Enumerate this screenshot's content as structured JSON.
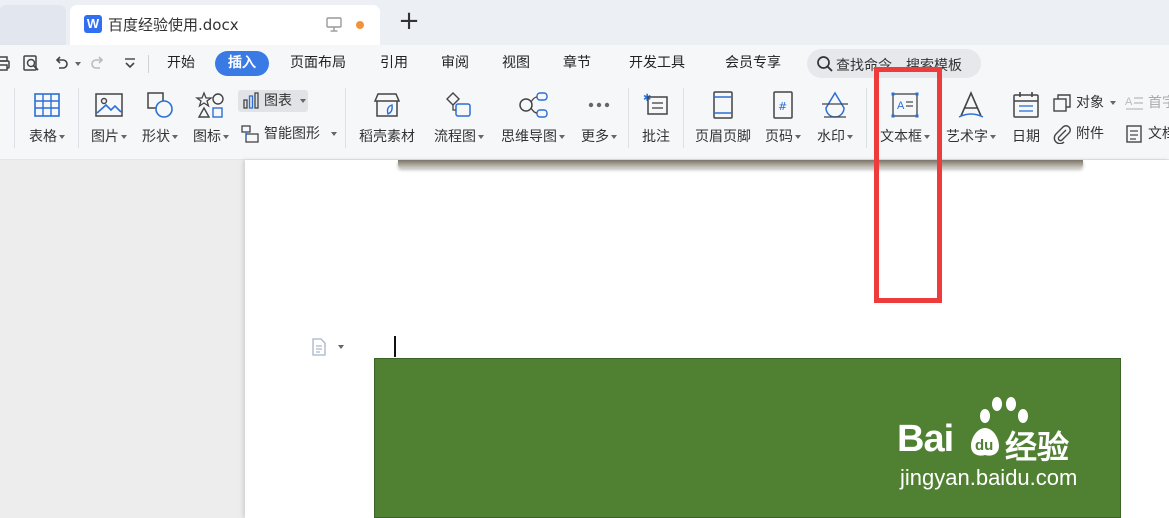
{
  "titlebar": {
    "doc_tab": {
      "logo_letter": "W",
      "title": "百度经验使用.docx"
    }
  },
  "menubar": {
    "tabs": [
      {
        "label": "开始",
        "active": false
      },
      {
        "label": "插入",
        "active": true
      },
      {
        "label": "页面布局",
        "active": false
      },
      {
        "label": "引用",
        "active": false
      },
      {
        "label": "审阅",
        "active": false
      },
      {
        "label": "视图",
        "active": false
      },
      {
        "label": "章节",
        "active": false
      },
      {
        "label": "开发工具",
        "active": false
      },
      {
        "label": "会员专享",
        "active": false
      }
    ],
    "search_label": "查找命令、搜索模板"
  },
  "ribbon": {
    "table": "表格",
    "picture": "图片",
    "shape": "形状",
    "icon": "图标",
    "chart": "图表",
    "smart_art": "智能图形",
    "daoke": "稻壳素材",
    "flowchart": "流程图",
    "mindmap": "思维导图",
    "more": "更多",
    "comment": "批注",
    "header_footer": "页眉页脚",
    "page_number": "页码",
    "watermark": "水印",
    "textbox": "文本框",
    "wordart": "艺术字",
    "date": "日期",
    "object": "对象",
    "attachment": "附件",
    "dropcap": "首字",
    "doc_part": "文档"
  },
  "watermark": {
    "brand": "Bai",
    "brand_cn": "经验",
    "url": "jingyan.baidu.com"
  },
  "colors": {
    "accent": "#3a7ae4",
    "highlight": "#ee3b3b",
    "green_block": "#508132"
  }
}
